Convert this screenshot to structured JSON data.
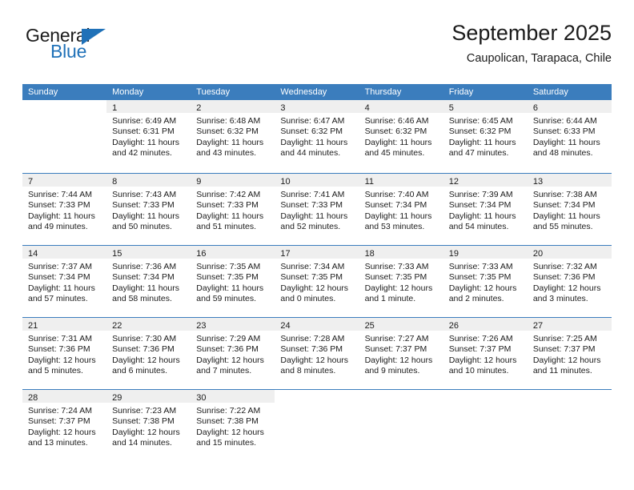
{
  "logo": {
    "text_top": "General",
    "text_bottom": "Blue"
  },
  "header": {
    "title": "September 2025",
    "subtitle": "Caupolican, Tarapaca, Chile"
  },
  "weekdays": [
    "Sunday",
    "Monday",
    "Tuesday",
    "Wednesday",
    "Thursday",
    "Friday",
    "Saturday"
  ],
  "colors": {
    "header_blue": "#3b7dbd",
    "cell_head_gray": "#efefef",
    "logo_blue": "#1f71b8",
    "text": "#1b1b1b"
  },
  "weeks": [
    [
      {
        "day": "",
        "sunrise": "",
        "sunset": "",
        "daylight_1": "",
        "daylight_2": ""
      },
      {
        "day": "1",
        "sunrise": "Sunrise: 6:49 AM",
        "sunset": "Sunset: 6:31 PM",
        "daylight_1": "Daylight: 11 hours",
        "daylight_2": "and 42 minutes."
      },
      {
        "day": "2",
        "sunrise": "Sunrise: 6:48 AM",
        "sunset": "Sunset: 6:32 PM",
        "daylight_1": "Daylight: 11 hours",
        "daylight_2": "and 43 minutes."
      },
      {
        "day": "3",
        "sunrise": "Sunrise: 6:47 AM",
        "sunset": "Sunset: 6:32 PM",
        "daylight_1": "Daylight: 11 hours",
        "daylight_2": "and 44 minutes."
      },
      {
        "day": "4",
        "sunrise": "Sunrise: 6:46 AM",
        "sunset": "Sunset: 6:32 PM",
        "daylight_1": "Daylight: 11 hours",
        "daylight_2": "and 45 minutes."
      },
      {
        "day": "5",
        "sunrise": "Sunrise: 6:45 AM",
        "sunset": "Sunset: 6:32 PM",
        "daylight_1": "Daylight: 11 hours",
        "daylight_2": "and 47 minutes."
      },
      {
        "day": "6",
        "sunrise": "Sunrise: 6:44 AM",
        "sunset": "Sunset: 6:33 PM",
        "daylight_1": "Daylight: 11 hours",
        "daylight_2": "and 48 minutes."
      }
    ],
    [
      {
        "day": "7",
        "sunrise": "Sunrise: 7:44 AM",
        "sunset": "Sunset: 7:33 PM",
        "daylight_1": "Daylight: 11 hours",
        "daylight_2": "and 49 minutes."
      },
      {
        "day": "8",
        "sunrise": "Sunrise: 7:43 AM",
        "sunset": "Sunset: 7:33 PM",
        "daylight_1": "Daylight: 11 hours",
        "daylight_2": "and 50 minutes."
      },
      {
        "day": "9",
        "sunrise": "Sunrise: 7:42 AM",
        "sunset": "Sunset: 7:33 PM",
        "daylight_1": "Daylight: 11 hours",
        "daylight_2": "and 51 minutes."
      },
      {
        "day": "10",
        "sunrise": "Sunrise: 7:41 AM",
        "sunset": "Sunset: 7:33 PM",
        "daylight_1": "Daylight: 11 hours",
        "daylight_2": "and 52 minutes."
      },
      {
        "day": "11",
        "sunrise": "Sunrise: 7:40 AM",
        "sunset": "Sunset: 7:34 PM",
        "daylight_1": "Daylight: 11 hours",
        "daylight_2": "and 53 minutes."
      },
      {
        "day": "12",
        "sunrise": "Sunrise: 7:39 AM",
        "sunset": "Sunset: 7:34 PM",
        "daylight_1": "Daylight: 11 hours",
        "daylight_2": "and 54 minutes."
      },
      {
        "day": "13",
        "sunrise": "Sunrise: 7:38 AM",
        "sunset": "Sunset: 7:34 PM",
        "daylight_1": "Daylight: 11 hours",
        "daylight_2": "and 55 minutes."
      }
    ],
    [
      {
        "day": "14",
        "sunrise": "Sunrise: 7:37 AM",
        "sunset": "Sunset: 7:34 PM",
        "daylight_1": "Daylight: 11 hours",
        "daylight_2": "and 57 minutes."
      },
      {
        "day": "15",
        "sunrise": "Sunrise: 7:36 AM",
        "sunset": "Sunset: 7:34 PM",
        "daylight_1": "Daylight: 11 hours",
        "daylight_2": "and 58 minutes."
      },
      {
        "day": "16",
        "sunrise": "Sunrise: 7:35 AM",
        "sunset": "Sunset: 7:35 PM",
        "daylight_1": "Daylight: 11 hours",
        "daylight_2": "and 59 minutes."
      },
      {
        "day": "17",
        "sunrise": "Sunrise: 7:34 AM",
        "sunset": "Sunset: 7:35 PM",
        "daylight_1": "Daylight: 12 hours",
        "daylight_2": "and 0 minutes."
      },
      {
        "day": "18",
        "sunrise": "Sunrise: 7:33 AM",
        "sunset": "Sunset: 7:35 PM",
        "daylight_1": "Daylight: 12 hours",
        "daylight_2": "and 1 minute."
      },
      {
        "day": "19",
        "sunrise": "Sunrise: 7:33 AM",
        "sunset": "Sunset: 7:35 PM",
        "daylight_1": "Daylight: 12 hours",
        "daylight_2": "and 2 minutes."
      },
      {
        "day": "20",
        "sunrise": "Sunrise: 7:32 AM",
        "sunset": "Sunset: 7:36 PM",
        "daylight_1": "Daylight: 12 hours",
        "daylight_2": "and 3 minutes."
      }
    ],
    [
      {
        "day": "21",
        "sunrise": "Sunrise: 7:31 AM",
        "sunset": "Sunset: 7:36 PM",
        "daylight_1": "Daylight: 12 hours",
        "daylight_2": "and 5 minutes."
      },
      {
        "day": "22",
        "sunrise": "Sunrise: 7:30 AM",
        "sunset": "Sunset: 7:36 PM",
        "daylight_1": "Daylight: 12 hours",
        "daylight_2": "and 6 minutes."
      },
      {
        "day": "23",
        "sunrise": "Sunrise: 7:29 AM",
        "sunset": "Sunset: 7:36 PM",
        "daylight_1": "Daylight: 12 hours",
        "daylight_2": "and 7 minutes."
      },
      {
        "day": "24",
        "sunrise": "Sunrise: 7:28 AM",
        "sunset": "Sunset: 7:36 PM",
        "daylight_1": "Daylight: 12 hours",
        "daylight_2": "and 8 minutes."
      },
      {
        "day": "25",
        "sunrise": "Sunrise: 7:27 AM",
        "sunset": "Sunset: 7:37 PM",
        "daylight_1": "Daylight: 12 hours",
        "daylight_2": "and 9 minutes."
      },
      {
        "day": "26",
        "sunrise": "Sunrise: 7:26 AM",
        "sunset": "Sunset: 7:37 PM",
        "daylight_1": "Daylight: 12 hours",
        "daylight_2": "and 10 minutes."
      },
      {
        "day": "27",
        "sunrise": "Sunrise: 7:25 AM",
        "sunset": "Sunset: 7:37 PM",
        "daylight_1": "Daylight: 12 hours",
        "daylight_2": "and 11 minutes."
      }
    ],
    [
      {
        "day": "28",
        "sunrise": "Sunrise: 7:24 AM",
        "sunset": "Sunset: 7:37 PM",
        "daylight_1": "Daylight: 12 hours",
        "daylight_2": "and 13 minutes."
      },
      {
        "day": "29",
        "sunrise": "Sunrise: 7:23 AM",
        "sunset": "Sunset: 7:38 PM",
        "daylight_1": "Daylight: 12 hours",
        "daylight_2": "and 14 minutes."
      },
      {
        "day": "30",
        "sunrise": "Sunrise: 7:22 AM",
        "sunset": "Sunset: 7:38 PM",
        "daylight_1": "Daylight: 12 hours",
        "daylight_2": "and 15 minutes."
      },
      {
        "day": "",
        "sunrise": "",
        "sunset": "",
        "daylight_1": "",
        "daylight_2": ""
      },
      {
        "day": "",
        "sunrise": "",
        "sunset": "",
        "daylight_1": "",
        "daylight_2": ""
      },
      {
        "day": "",
        "sunrise": "",
        "sunset": "",
        "daylight_1": "",
        "daylight_2": ""
      },
      {
        "day": "",
        "sunrise": "",
        "sunset": "",
        "daylight_1": "",
        "daylight_2": ""
      }
    ]
  ]
}
